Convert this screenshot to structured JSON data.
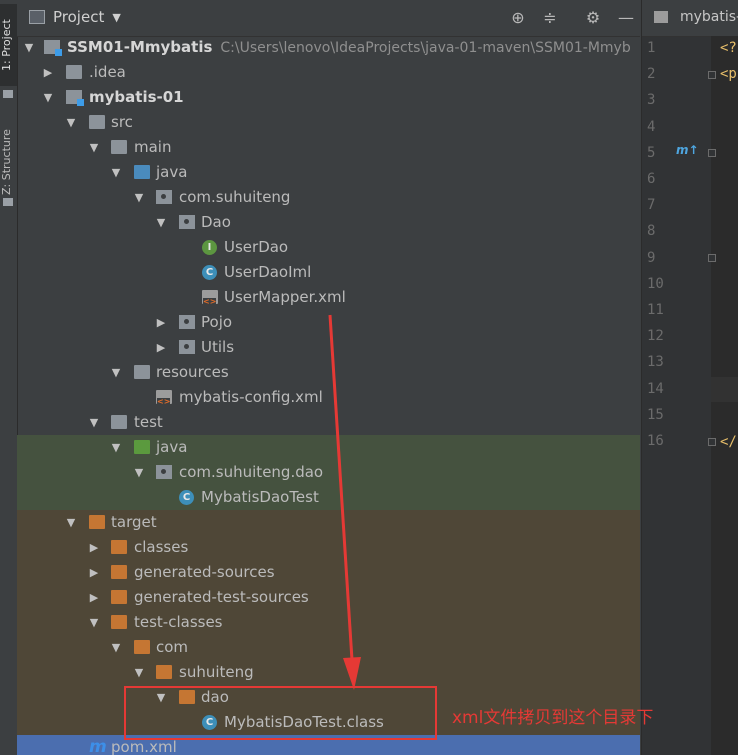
{
  "sidebar": {
    "tab_project": "1: Project",
    "tab_structure": "Z: Structure"
  },
  "header": {
    "title": "Project",
    "buttons": [
      "locate-icon",
      "collapse-icon",
      "gear-icon",
      "minimize-icon"
    ]
  },
  "tree": {
    "root_name": "SSM01-Mmybatis",
    "root_path": "C:\\Users\\lenovo\\IdeaProjects\\java-01-maven\\SSM01-Mmyb",
    "items": [
      "SSM01-Mmybatis",
      ".idea",
      "mybatis-01",
      "src",
      "main",
      "java",
      "com.suhuiteng",
      "Dao",
      "UserDao",
      "UserDaoIml",
      "UserMapper.xml",
      "Pojo",
      "Utils",
      "resources",
      "mybatis-config.xml",
      "test",
      "java",
      "com.suhuiteng.dao",
      "MybatisDaoTest",
      "target",
      "classes",
      "generated-sources",
      "generated-test-sources",
      "test-classes",
      "com",
      "suhuiteng",
      "dao",
      "MybatisDaoTest.class",
      "pom.xml"
    ]
  },
  "editor": {
    "tab_label": "mybatis-",
    "line_numbers": [
      "1",
      "2",
      "3",
      "4",
      "5",
      "6",
      "7",
      "8",
      "9",
      "10",
      "11",
      "12",
      "13",
      "14",
      "15",
      "16"
    ],
    "code_fragments": [
      "<?",
      "<p",
      "</"
    ],
    "gutter_mark": "m↑"
  },
  "annotation": {
    "text": "xml文件拷贝到这个目录下"
  }
}
